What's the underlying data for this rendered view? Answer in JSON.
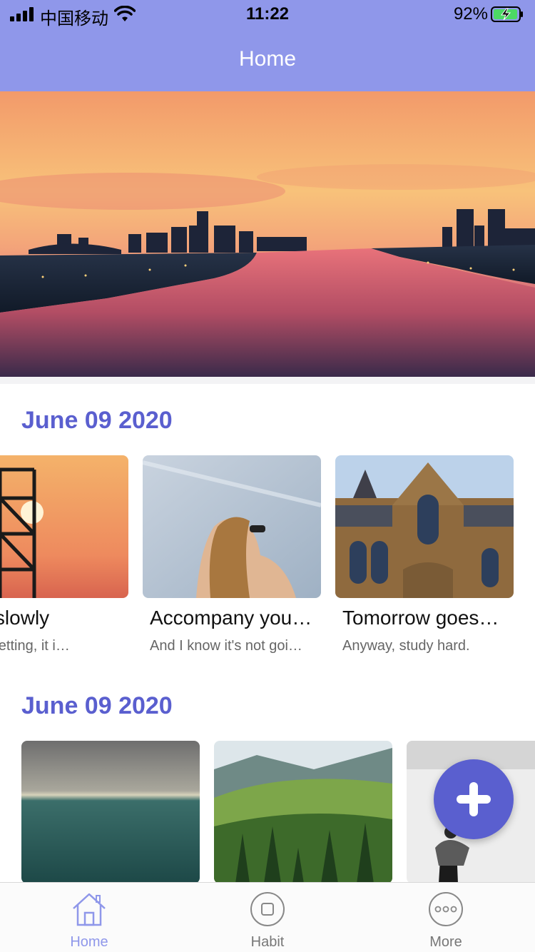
{
  "status_bar": {
    "carrier": "中国移动",
    "time": "11:22",
    "battery": "92%"
  },
  "header": {
    "title": "Home"
  },
  "sections": [
    {
      "date": "June 09 2020",
      "cards": [
        {
          "title": "sun slowly",
          "desc": "un is setting, it i…"
        },
        {
          "title": "Accompany you…",
          "desc": "And I know it's not goi…"
        },
        {
          "title": "Tomorrow goes…",
          "desc": "Anyway, study hard."
        }
      ]
    },
    {
      "date": "June 09 2020",
      "cards": [
        {
          "title": "",
          "desc": ""
        },
        {
          "title": "",
          "desc": ""
        },
        {
          "title": "",
          "desc": ""
        }
      ]
    }
  ],
  "fab": {
    "icon": "plus-icon"
  },
  "tabs": [
    {
      "label": "Home",
      "icon": "home-icon",
      "active": true
    },
    {
      "label": "Habit",
      "icon": "square-circle-icon",
      "active": false
    },
    {
      "label": "More",
      "icon": "more-dots-icon",
      "active": false
    }
  ],
  "colors": {
    "header": "#8f97ea",
    "accent": "#5a5fcf"
  }
}
